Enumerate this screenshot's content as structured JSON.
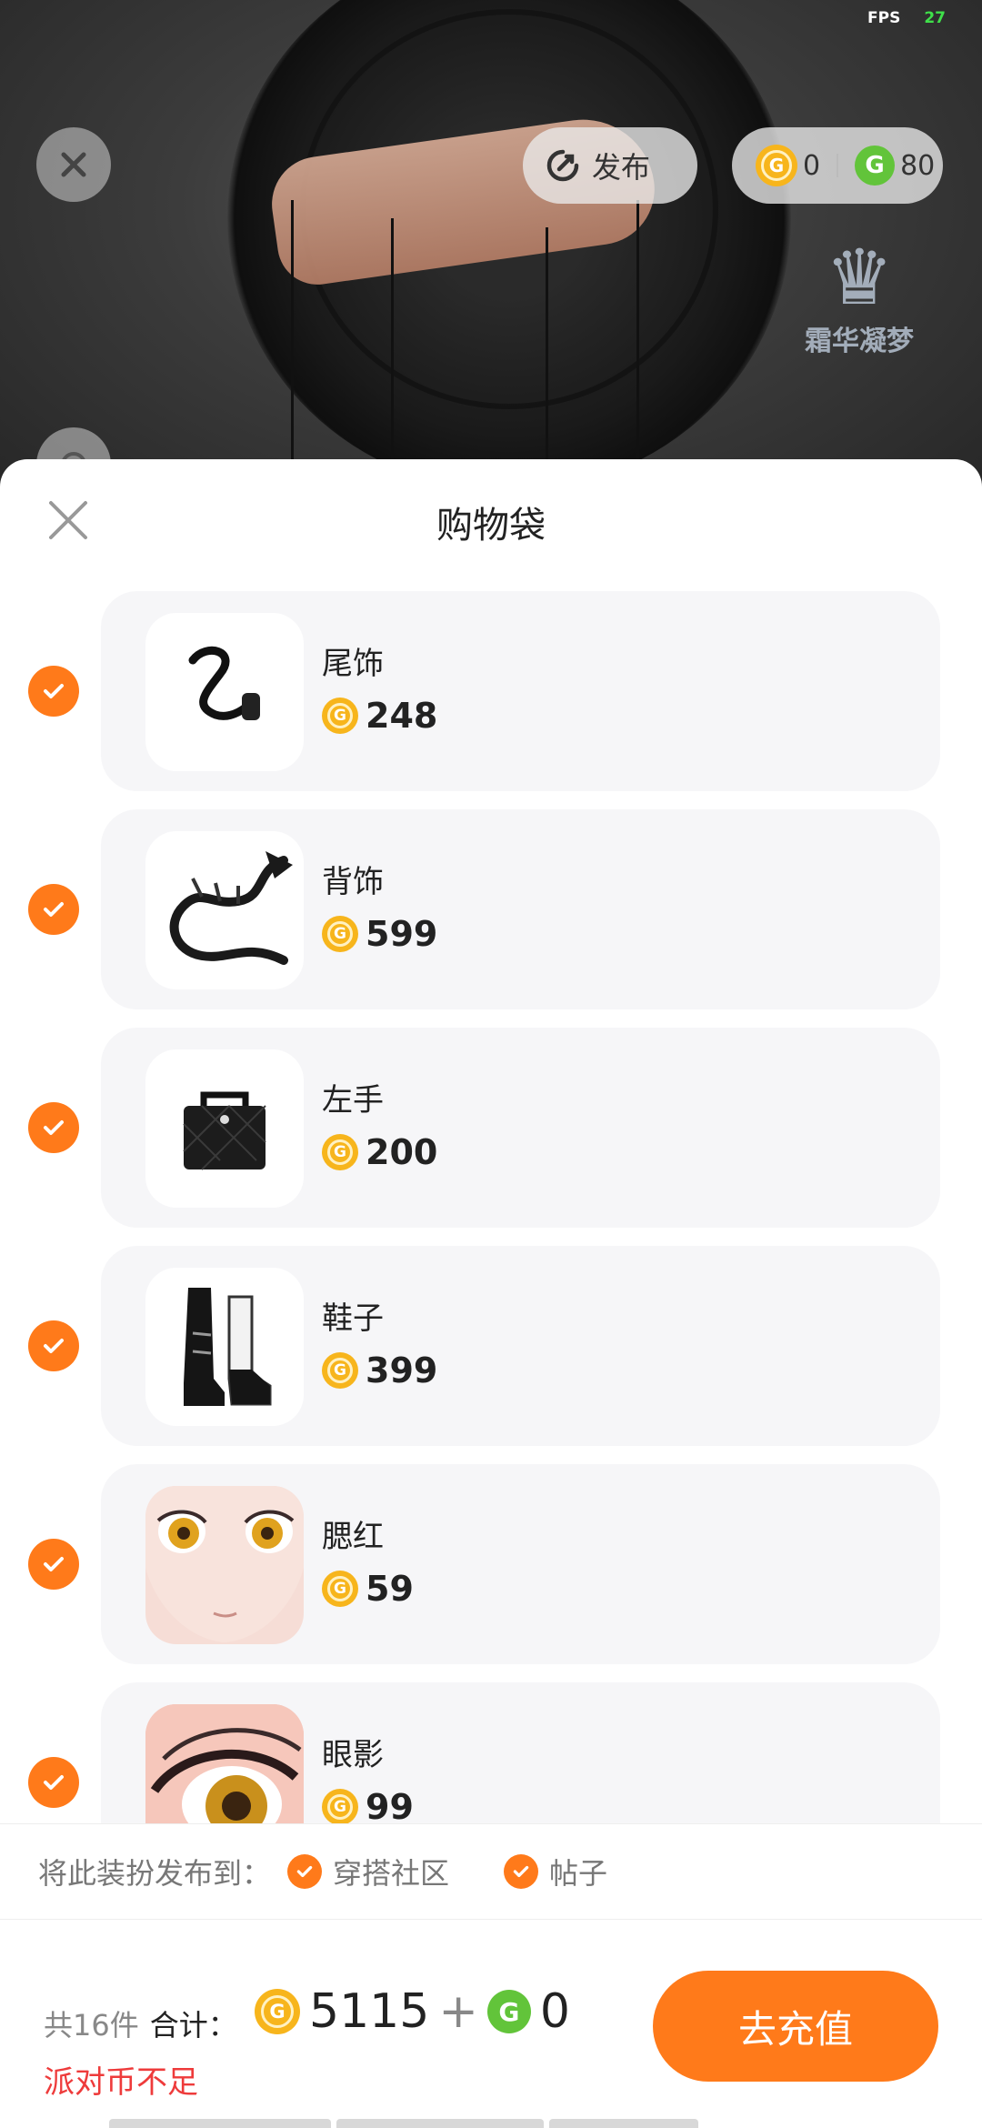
{
  "status": {
    "fps_label": "FPS",
    "fps_value": "27"
  },
  "scene": {
    "watermark_text": "霜华凝梦"
  },
  "topbar": {
    "publish_label": "发布",
    "gold_balance": "0",
    "green_balance": "80"
  },
  "sheet": {
    "title": "购物袋",
    "items": [
      {
        "name": "尾饰",
        "price": "248",
        "icon": "tail-accessory-icon"
      },
      {
        "name": "背饰",
        "price": "599",
        "icon": "dragon-back-accessory-icon"
      },
      {
        "name": "左手",
        "price": "200",
        "icon": "handbag-icon"
      },
      {
        "name": "鞋子",
        "price": "399",
        "icon": "boots-icon"
      },
      {
        "name": "腮红",
        "price": "59",
        "icon": "face-blush-icon"
      },
      {
        "name": "眼影",
        "price": "99",
        "icon": "eye-shadow-icon"
      }
    ]
  },
  "publish_to": {
    "label": "将此装扮发布到：",
    "options": [
      {
        "label": "穿搭社区"
      },
      {
        "label": "帖子"
      }
    ]
  },
  "footer": {
    "count_text": "共16件",
    "total_label": "合计：",
    "gold_total": "5115",
    "plus": "+",
    "green_total": "0",
    "warning": "派对币不足",
    "button_label": "去充值"
  },
  "colors": {
    "accent": "#ff7a1a",
    "warning": "#ee3b3b",
    "gold": "#f7b51c",
    "green": "#62c43a"
  }
}
